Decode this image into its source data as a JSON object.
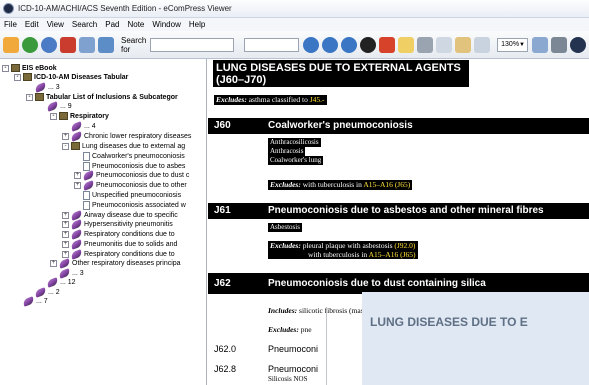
{
  "window": {
    "title": "ICD-10-AM/ACHI/ACS Seventh Edition - eComPress Viewer"
  },
  "menu": [
    "File",
    "Edit",
    "View",
    "Search",
    "Pad",
    "Note",
    "Window",
    "Help"
  ],
  "toolbar": {
    "search_label": "Search for",
    "search_value": "",
    "zoom": "130%"
  },
  "tree": [
    {
      "label": "EIS eBook",
      "bold": true,
      "exp": "-",
      "icon": "book"
    },
    {
      "label": "ICD-10-AM Diseases Tabular",
      "bold": true,
      "exp": "-",
      "icon": "book"
    },
    {
      "label": "... 3",
      "bold": false,
      "exp": "",
      "icon": "feather"
    },
    {
      "label": "Tabular List of Inclusions & Subcategor",
      "bold": true,
      "exp": "-",
      "icon": "book"
    },
    {
      "label": "... 9",
      "bold": false,
      "exp": "",
      "icon": "feather"
    },
    {
      "label": "Respiratory",
      "bold": true,
      "exp": "-",
      "icon": "book"
    },
    {
      "label": "... 4",
      "bold": false,
      "exp": "",
      "icon": "feather"
    },
    {
      "label": "Chronic lower respiratory diseases",
      "bold": false,
      "exp": "+",
      "icon": "feather"
    },
    {
      "label": "Lung diseases due to external ag",
      "bold": false,
      "exp": "-",
      "icon": "book"
    },
    {
      "label": "Coalworker's pneumoconiosis",
      "bold": false,
      "exp": "",
      "icon": "page"
    },
    {
      "label": "Pneumoconiosis due to asbes",
      "bold": false,
      "exp": "",
      "icon": "page"
    },
    {
      "label": "Pneumoconiosis due to dust c",
      "bold": false,
      "exp": "+",
      "icon": "feather"
    },
    {
      "label": "Pneumoconiosis due to other",
      "bold": false,
      "exp": "+",
      "icon": "feather"
    },
    {
      "label": "Unspecified pneumoconiosis",
      "bold": false,
      "exp": "",
      "icon": "page"
    },
    {
      "label": "Pneumoconiosis associated w",
      "bold": false,
      "exp": "",
      "icon": "page"
    },
    {
      "label": "Airway disease due to specific",
      "bold": false,
      "exp": "+",
      "icon": "feather"
    },
    {
      "label": "Hypersensitivity pneumonitis",
      "bold": false,
      "exp": "+",
      "icon": "feather"
    },
    {
      "label": "Respiratory conditions due to",
      "bold": false,
      "exp": "+",
      "icon": "feather"
    },
    {
      "label": "Pneumonitis due to solids and",
      "bold": false,
      "exp": "+",
      "icon": "feather"
    },
    {
      "label": "Respiratory conditions due to",
      "bold": false,
      "exp": "+",
      "icon": "feather"
    },
    {
      "label": "Other respiratory diseases principa",
      "bold": false,
      "exp": "+",
      "icon": "feather"
    },
    {
      "label": "... 3",
      "bold": false,
      "exp": "",
      "icon": "feather"
    },
    {
      "label": "... 12",
      "bold": false,
      "exp": "",
      "icon": "feather"
    },
    {
      "label": "... 2",
      "bold": false,
      "exp": "",
      "icon": "feather"
    },
    {
      "label": "... 7",
      "bold": false,
      "exp": "",
      "icon": "feather"
    }
  ],
  "content": {
    "title_line1": "LUNG DISEASES DUE TO EXTERNAL AGENTS",
    "title_line2": "(J60–J70)",
    "excludes_label": "Excludes:",
    "title_excludes_text": "asthma classified to ",
    "title_excludes_code": "J45.-",
    "j60": {
      "code": "J60",
      "heading": "Coalworker's pneumoconiosis",
      "inclusions": [
        "Anthracosilicosis",
        "Anthracosis",
        "Coalworker's lung"
      ],
      "excludes_text": "with tuberculosis in ",
      "excludes_code1": "A15–A16",
      "excludes_code2": "(J65)"
    },
    "j61": {
      "code": "J61",
      "heading": "Pneumoconiosis due to asbestos and other mineral fibres",
      "inclusions": [
        "Asbestosis"
      ],
      "excludes_text1": "pleural plaque with asbestosis ",
      "excludes_code1": "(J92.0)",
      "excludes_text2": "with tuberculosis in ",
      "excludes_code2": "A15–A16",
      "excludes_code3": "(J65)"
    },
    "j62": {
      "code": "J62",
      "heading": "Pneumoconiosis due to dust containing silica",
      "includes_label": "Includes:",
      "includes_text": "silicotic fibrosis (massive) of lung",
      "excludes_label": "Excludes:",
      "excludes_text": "pne"
    },
    "j620": {
      "code": "J62.0",
      "text": "Pneumoconi"
    },
    "j628": {
      "code": "J62.8",
      "text": "Pneumoconi",
      "sub": "Silicosis NOS"
    },
    "overlay_title": "LUNG DISEASES DUE TO E"
  }
}
